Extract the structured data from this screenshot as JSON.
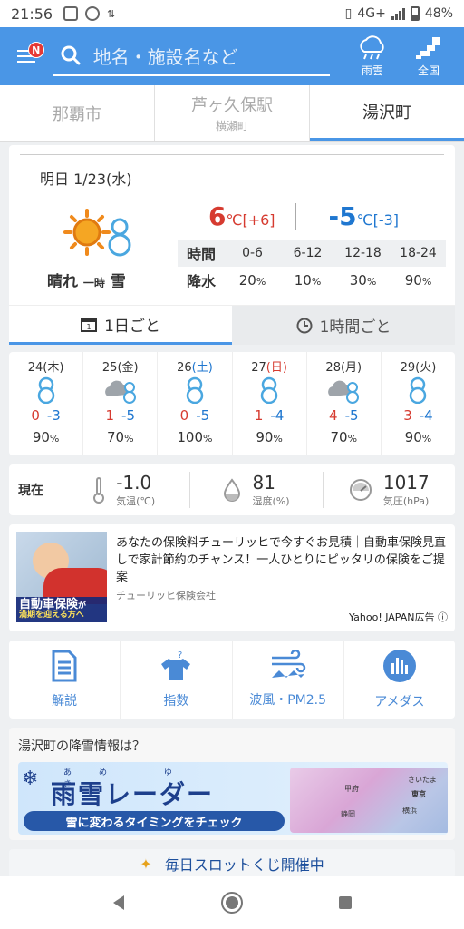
{
  "status": {
    "time": "21:56",
    "network": "4G+",
    "battery": "48%"
  },
  "header": {
    "badge": "N",
    "search_placeholder": "地名・施設名など",
    "rain_label": "雨雲",
    "nation_label": "全国"
  },
  "locations": [
    {
      "name": "那覇市",
      "sub": ""
    },
    {
      "name": "芦ヶ久保駅",
      "sub": "横瀬町"
    },
    {
      "name": "湯沢町",
      "sub": ""
    }
  ],
  "forecast": {
    "date_label": "明日",
    "date": "1/23(水)",
    "weather_main": "晴れ",
    "weather_mid": "一時",
    "weather_tail": "雪",
    "tmax": "6",
    "tmax_diff": "[+6]",
    "tmin": "-5",
    "tmin_diff": "[-3]",
    "unit": "℃",
    "time_label": "時間",
    "precip_label": "降水",
    "periods": [
      "0-6",
      "6-12",
      "12-18",
      "18-24"
    ],
    "precip": [
      "20",
      "10",
      "30",
      "90"
    ],
    "pct": "%"
  },
  "view_tabs": {
    "daily": "1日ごと",
    "hourly": "1時間ごと"
  },
  "daily": [
    {
      "day": "24",
      "dow": "(木)",
      "icon": "snowman",
      "hi": "0",
      "lo": "-3",
      "pop": "90"
    },
    {
      "day": "25",
      "dow": "(金)",
      "icon": "cloud-snowman",
      "hi": "1",
      "lo": "-5",
      "pop": "70"
    },
    {
      "day": "26",
      "dow": "(土)",
      "icon": "snowman",
      "hi": "0",
      "lo": "-5",
      "pop": "100"
    },
    {
      "day": "27",
      "dow": "(日)",
      "icon": "snowman",
      "hi": "1",
      "lo": "-4",
      "pop": "90"
    },
    {
      "day": "28",
      "dow": "(月)",
      "icon": "cloud-snowman",
      "hi": "4",
      "lo": "-5",
      "pop": "70"
    },
    {
      "day": "29",
      "dow": "(火)",
      "icon": "snowman",
      "hi": "3",
      "lo": "-4",
      "pop": "90"
    }
  ],
  "current": {
    "label": "現在",
    "temp": "-1.0",
    "temp_unit": "気温(℃)",
    "humidity": "81",
    "humidity_unit": "湿度(%)",
    "pressure": "1017",
    "pressure_unit": "気圧(hPa)"
  },
  "ad": {
    "image_title": "自動車保険",
    "image_title_suffix": "が",
    "image_sub": "満期を迎える方へ",
    "text": "あなたの保険料チューリッヒで今すぐお見積｜自動車保険見直しで家計節約のチャンス！一人ひとりにピッタリの保険をご提案",
    "source": "チューリッヒ保険会社",
    "label": "Yahoo! JAPAN広告"
  },
  "menu": [
    {
      "label": "解説",
      "icon": "document-icon"
    },
    {
      "label": "指数",
      "icon": "shirt-icon"
    },
    {
      "label": "波風・PM2.5",
      "icon": "wave-icon"
    },
    {
      "label": "アメダス",
      "icon": "amedas-icon"
    }
  ],
  "snow": {
    "question": "湯沢町の降雪情報は？",
    "banner_title": "雨雪レーダー",
    "furigana": "あめ ゆき",
    "banner_sub": "雪に変わるタイミングをチェック",
    "map_labels": [
      "さいたま",
      "東京",
      "横浜",
      "甲府",
      "静岡"
    ]
  },
  "slot": {
    "label": "毎日スロットくじ開催中"
  },
  "colors": {
    "accent": "#4a96e6",
    "high": "#d63b30",
    "low": "#1f77d0"
  }
}
